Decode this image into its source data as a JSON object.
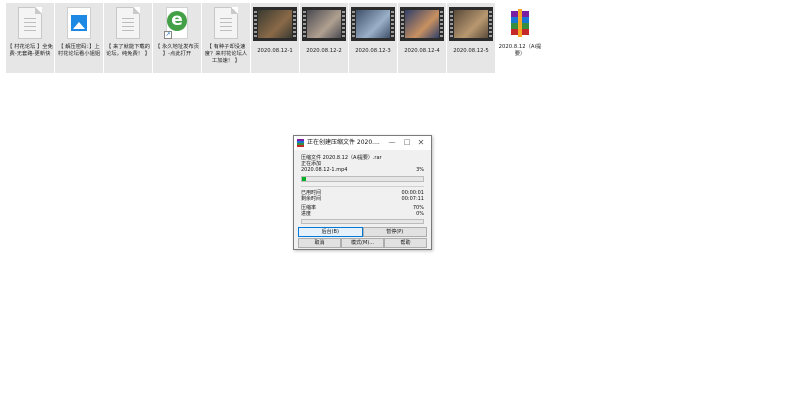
{
  "files": [
    {
      "kind": "doc",
      "name": "【 村花论坛 】全免费-无套路-更新快",
      "selected": true
    },
    {
      "kind": "image",
      "name": "【 解压密码：】上村花论坛看小姐姐",
      "selected": true
    },
    {
      "kind": "doc",
      "name": "【 来了就能下载的论坛，纯免费！ 】",
      "selected": true
    },
    {
      "kind": "ie",
      "name": "【 永久地址发布页 】-点此打开",
      "selected": true
    },
    {
      "kind": "doc",
      "name": "【 有种子却没速度？来村花论坛人工加速！ 】",
      "selected": true
    },
    {
      "kind": "video",
      "name": "2020.08.12-1",
      "thumb_colors": [
        "#3a3a30",
        "#8a6a48"
      ],
      "selected": true
    },
    {
      "kind": "video",
      "name": "2020.08.12-2",
      "thumb_colors": [
        "#4a4a52",
        "#b0a090"
      ],
      "selected": true
    },
    {
      "kind": "video",
      "name": "2020.08.12-3",
      "thumb_colors": [
        "#40506a",
        "#9ab0c8"
      ],
      "selected": true
    },
    {
      "kind": "video",
      "name": "2020.08.12-4",
      "thumb_colors": [
        "#2f3f6a",
        "#c89060"
      ],
      "selected": true
    },
    {
      "kind": "video",
      "name": "2020.08.12-5",
      "thumb_colors": [
        "#5a4a3a",
        "#b89870"
      ],
      "selected": true
    },
    {
      "kind": "rar",
      "name": "2020.8.12（Ai提要）",
      "selected": false
    }
  ],
  "dialog": {
    "title": "正在创建压缩文件 2020....",
    "window_buttons": {
      "minimize": "—",
      "maximize": "□",
      "close": "✕"
    },
    "archive_label": "压缩文件 2020.8.12（Ai提要）.rar",
    "adding_label": "正在添加",
    "current_file": "2020.08.12-1.mp4",
    "current_percent": "3%",
    "current_progress": 0.03,
    "elapsed_label": "已用时间",
    "elapsed_value": "00:00:01",
    "remaining_label": "剩余时间",
    "remaining_value": "00:07:11",
    "ratio_label": "压缩率",
    "ratio_value": "70%",
    "progress_label": "进度",
    "progress_value": "0%",
    "progress_fraction": 0.0,
    "buttons": {
      "background": "后台(B)",
      "pause": "暂停(P)",
      "cancel": "取消",
      "mode": "模式(M)...",
      "help": "帮助"
    }
  }
}
